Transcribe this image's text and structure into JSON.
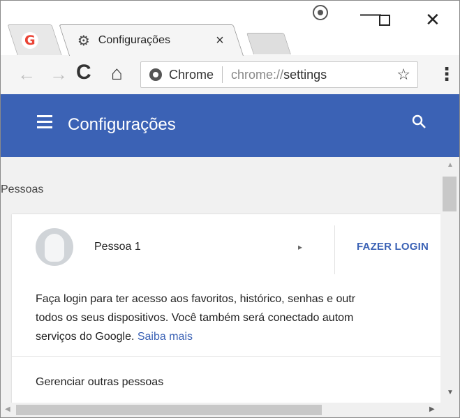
{
  "tabs": [
    {
      "icon": "google-g-icon",
      "logo_text": "G"
    },
    {
      "icon": "gear-icon",
      "title": "Configurações",
      "close": "×"
    },
    {
      "icon": "new-tab"
    }
  ],
  "window_controls": {
    "minimize": "—",
    "close": "✕"
  },
  "toolbar": {
    "back": "←",
    "forward": "→",
    "reload": "C",
    "home": "⌂",
    "omnibox": {
      "chip": "Chrome",
      "url_scheme": "chrome://",
      "url_path": "settings"
    },
    "star": "☆",
    "menu": "⋮"
  },
  "header": {
    "title": "Configurações",
    "search_icon": "🔍"
  },
  "content": {
    "section_label": "Pessoas",
    "person": {
      "name": "Pessoa 1",
      "arrow": "▸",
      "login_button": "FAZER LOGIN"
    },
    "description": {
      "line1": "Faça login para ter acesso aos favoritos, histórico, senhas e outr",
      "line2": "todos os seus dispositivos. Você também será conectado autom",
      "line3": "serviços do Google. ",
      "link": "Saiba mais"
    },
    "manage_people": "Gerenciar outras pessoas"
  },
  "scrollbars": {
    "up": "▲",
    "down": "▼",
    "left": "◀",
    "right": "▶"
  },
  "colors": {
    "accent": "#3b62b5",
    "content_bg": "#f1f1f1",
    "toolbar_bg": "#f5f5f5"
  }
}
